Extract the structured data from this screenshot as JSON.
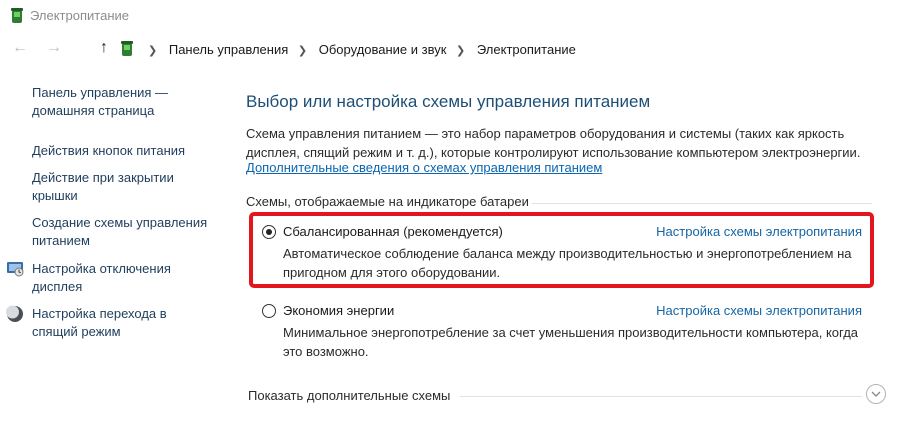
{
  "window": {
    "title": "Электропитание"
  },
  "nav": {
    "back_icon": "arrow-left-icon",
    "forward_icon": "arrow-right-icon",
    "up_icon": "arrow-up-icon",
    "breadcrumbs": [
      "Панель управления",
      "Оборудование и звук",
      "Электропитание"
    ]
  },
  "sidebar": {
    "home_line1": "Панель управления —",
    "home_line2": "домашняя страница",
    "items": [
      {
        "label": "Действия кнопок питания",
        "icon": ""
      },
      {
        "label_line1": "Действие при закрытии",
        "label_line2": "крышки",
        "icon": ""
      },
      {
        "label_line1": "Создание схемы управления",
        "label_line2": "питанием",
        "icon": ""
      },
      {
        "label_line1": "Настройка отключения",
        "label_line2": "дисплея",
        "icon": "monitor-icon"
      },
      {
        "label_line1": "Настройка перехода в",
        "label_line2": "спящий режим",
        "icon": "moon-icon"
      }
    ]
  },
  "main": {
    "heading": "Выбор или настройка схемы управления питанием",
    "description": "Схема управления питанием — это набор параметров оборудования и системы (таких как яркость дисплея, спящий режим и т. д.), которые контролируют использование компьютером электроэнергии.",
    "more_info_link": "Дополнительные сведения о схемах управления питанием",
    "group_label": "Схемы, отображаемые на индикаторе батареи",
    "plans": [
      {
        "name": "Сбалансированная (рекомендуется)",
        "selected": true,
        "config_link": "Настройка схемы электропитания",
        "description": "Автоматическое соблюдение баланса между производительностью и энергопотреблением на пригодном для этого оборудовании."
      },
      {
        "name": "Экономия энергии",
        "selected": false,
        "config_link": "Настройка схемы электропитания",
        "description": "Минимальное энергопотребление за счет уменьшения производительности компьютера, когда это возможно."
      }
    ],
    "show_more_schemes": "Показать дополнительные схемы"
  },
  "colors": {
    "highlight": "#e3151d",
    "link": "#0a66b0",
    "heading": "#1d4f76"
  }
}
